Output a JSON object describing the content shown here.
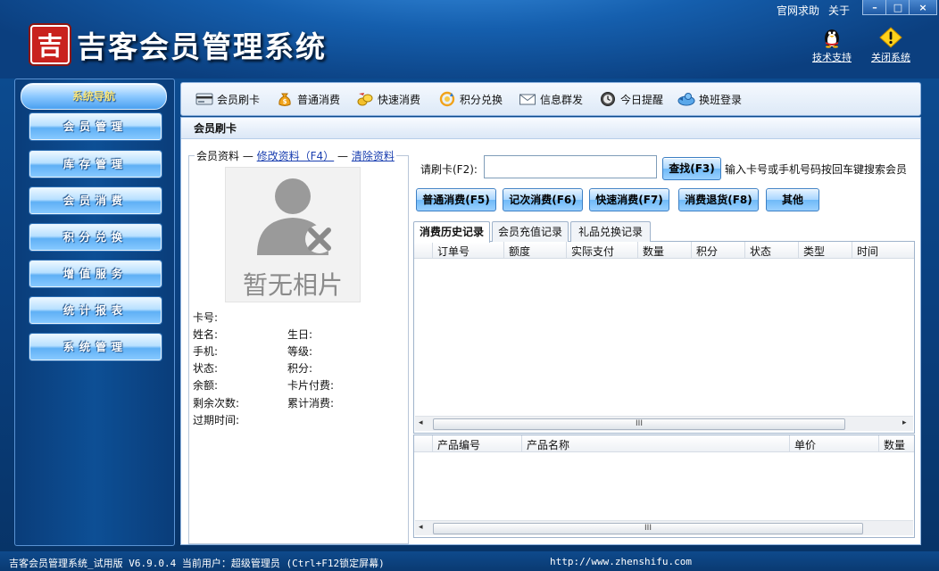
{
  "app": {
    "title": "吉客会员管理系统",
    "logo_char": "吉"
  },
  "top_links": {
    "official_help": "官网求助",
    "about": "关于"
  },
  "window_buttons": {
    "minimize": "–",
    "maximize": "□",
    "close": "×"
  },
  "header_tools": {
    "tech_support": "技术支持",
    "close_system": "关闭系统"
  },
  "sidebar": {
    "heading": "系统导航",
    "items": [
      {
        "label": "会员管理"
      },
      {
        "label": "库存管理"
      },
      {
        "label": "会员消费"
      },
      {
        "label": "积分兑换"
      },
      {
        "label": "增值服务"
      },
      {
        "label": "统计报表"
      },
      {
        "label": "系统管理"
      }
    ]
  },
  "toolbar": {
    "items": [
      {
        "label": "会员刷卡",
        "icon": "card-reader-icon"
      },
      {
        "label": "普通消费",
        "icon": "money-bag-icon"
      },
      {
        "label": "快速消费",
        "icon": "coins-icon"
      },
      {
        "label": "积分兑换",
        "icon": "refresh-coin-icon"
      },
      {
        "label": "信息群发",
        "icon": "envelope-icon"
      },
      {
        "label": "今日提醒",
        "icon": "clock-icon"
      },
      {
        "label": "换班登录",
        "icon": "swap-user-icon"
      }
    ]
  },
  "main": {
    "title": "会员刷卡",
    "info_legend": {
      "label": "会员资料",
      "edit_link": "修改资料（F4）",
      "clear_link": "清除资料"
    },
    "photo_placeholder": "暂无相片",
    "fields": {
      "card_no": "卡号:",
      "name": "姓名:",
      "birthday": "生日:",
      "phone": "手机:",
      "level": "等级:",
      "status": "状态:",
      "points": "积分:",
      "balance": "余额:",
      "card_fee": "卡片付费:",
      "remaining_times": "剩余次数:",
      "total_spent": "累计消费:",
      "expire_time": "过期时间:"
    },
    "swipe": {
      "label": "请刷卡(F2):",
      "value": "",
      "search_button": "查找(F3)",
      "hint": "输入卡号或手机号码按回车键搜索会员"
    },
    "actions": {
      "normal": "普通消费(F5)",
      "count": "记次消费(F6)",
      "quick": "快速消费(F7)",
      "refund": "消费退货(F8)",
      "other": "其他"
    },
    "tabs": [
      {
        "label": "消费历史记录",
        "active": true
      },
      {
        "label": "会员充值记录",
        "active": false
      },
      {
        "label": "礼品兑换记录",
        "active": false
      }
    ],
    "history_columns": [
      "订单号",
      "额度",
      "实际支付",
      "数量",
      "积分",
      "状态",
      "类型",
      "时间"
    ],
    "product_columns": [
      "产品编号",
      "产品名称",
      "单价",
      "数量"
    ],
    "scroll_thumb": "III"
  },
  "status_bar": {
    "left": "吉客会员管理系统_试用版 V6.9.0.4 当前用户：超级管理员 (Ctrl+F12锁定屏幕)",
    "url": "http://www.zhenshifu.com"
  }
}
